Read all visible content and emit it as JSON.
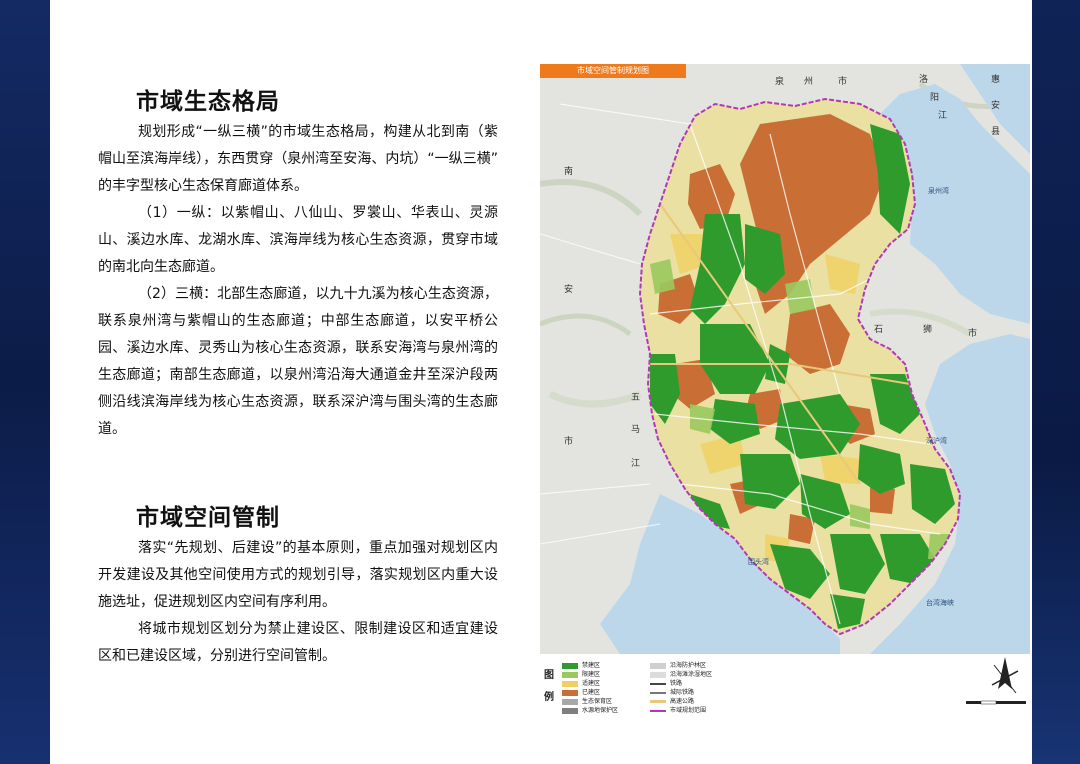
{
  "section1": {
    "title": "市域生态格局",
    "paragraphs": [
      "规划形成“一纵三横”的市域生态格局，构建从北到南（紫帽山至滨海岸线），东西贯穿（泉州湾至安海、内坑）“一纵三横” 的丰字型核心生态保育廊道体系。",
      "（1）一纵：以紫帽山、八仙山、罗裳山、华表山、灵源山、溪边水库、龙湖水库、滨海岸线为核心生态资源，贯穿市域的南北向生态廊道。",
      "（2）三横：北部生态廊道，以九十九溪为核心生态资源，联系泉州湾与紫帽山的生态廊道；中部生态廊道，以安平桥公园、溪边水库、灵秀山为核心生态资源，联系安海湾与泉州湾的生态廊道；南部生态廊道，以泉州湾沿海大通道金井至深沪段两侧沿线滨海岸线为核心生态资源，联系深沪湾与围头湾的生态廊道。"
    ]
  },
  "section2": {
    "title": "市域空间管制",
    "paragraphs": [
      "落实“先规划、后建设”的基本原则，重点加强对规划区内开发建设及其他空间使用方式的规划引导，落实规划区内重大设施选址，促进规划区内空间有序利用。",
      "将城市规划区划分为禁止建设区、限制建设区和适宜建设区和已建设区域，分别进行空间管制。"
    ]
  },
  "map": {
    "title": "市域空间管制规划图",
    "labels": {
      "quan": "泉",
      "zhou": "州",
      "shi_n": "市",
      "luo": "洛",
      "yang": "阳",
      "jiang": "江",
      "hui": "惠",
      "an2": "安",
      "xian": "县",
      "nan": "南",
      "an": "安",
      "shi_w": "市",
      "shi": "石",
      "shi2": "狮",
      "shi3": "市",
      "wu": "五",
      "ma": "马",
      "jiang2": "江",
      "shi_sw": "市",
      "quanzhou_bay": "泉州湾",
      "shenhu_bay": "深沪湾",
      "weitou_bay": "围头湾",
      "taiwan_strait": "台湾海峡"
    },
    "colors": {
      "sea": "#bcd7ea",
      "land_outside": "#e3e4df",
      "land_inside": "#eae0a2",
      "forbidden": "#2f9b2d",
      "restricted": "#f0d064",
      "built": "#c96f35",
      "boundary": "#b03ab5"
    }
  },
  "legend": {
    "title_top": "图",
    "title_bottom": "例",
    "items_left": [
      {
        "label": "禁建区",
        "color": "#2f9b2d"
      },
      {
        "label": "限建区",
        "color": "#9ac95f"
      },
      {
        "label": "适建区",
        "color": "#f0d064"
      },
      {
        "label": "已建区",
        "color": "#c96f35"
      },
      {
        "label": "生态保育区",
        "color": "#a8a8a8"
      },
      {
        "label": "水源地保护区",
        "color": "#7f7f7f"
      }
    ],
    "items_right": [
      {
        "label": "沿海防护林区",
        "color": "#cfcfcf"
      },
      {
        "label": "沿海滩涂湿地区",
        "color": "#dcdcdc"
      },
      {
        "label": "铁路",
        "color": "#444444"
      },
      {
        "label": "城际铁路",
        "color": "#777777"
      },
      {
        "label": "高速公路",
        "color": "#e8c87a"
      },
      {
        "label": "市域规划范围",
        "color": "#b03ab5"
      }
    ]
  }
}
